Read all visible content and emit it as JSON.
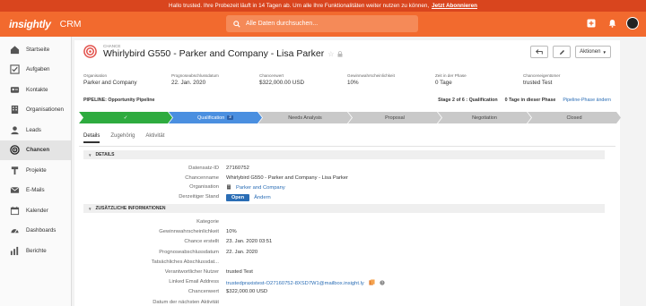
{
  "banner": {
    "message": "Hallo trusted. Ihre Probezeit läuft in 14 Tagen ab. Um alle Ihre Funktionalitäten weiter nutzen zu können,",
    "cta": "Jetzt Abonnieren"
  },
  "topbar": {
    "logo": "insightly",
    "app": "CRM",
    "search_placeholder": "Alle Daten durchsuchen..."
  },
  "sidebar": {
    "items": [
      {
        "label": "Startseite",
        "icon": "home-icon"
      },
      {
        "label": "Aufgaben",
        "icon": "checkbox-icon"
      },
      {
        "label": "Kontakte",
        "icon": "contact-card-icon"
      },
      {
        "label": "Organisationen",
        "icon": "building-icon"
      },
      {
        "label": "Leads",
        "icon": "leads-icon"
      },
      {
        "label": "Chancen",
        "icon": "target-icon"
      },
      {
        "label": "Projekte",
        "icon": "hammer-icon"
      },
      {
        "label": "E-Mails",
        "icon": "envelope-icon"
      },
      {
        "label": "Kalender",
        "icon": "calendar-icon"
      },
      {
        "label": "Dashboards",
        "icon": "dashboard-icon"
      },
      {
        "label": "Berichte",
        "icon": "report-icon"
      }
    ],
    "active_index": 5
  },
  "record": {
    "kicker": "CHANCE",
    "title": "Whirlybird G550 - Parker and Company - Lisa Parker",
    "actions_label": "Aktionen"
  },
  "fields": [
    {
      "label": "Organisation",
      "value": "Parker and Company",
      "link": true
    },
    {
      "label": "Prognoseabschlussdatum",
      "value": "22. Jan. 2020",
      "link": false
    },
    {
      "label": "Chancenwert",
      "value": "$322,000.00 USD",
      "link": false
    },
    {
      "label": "Gewinnwahrscheinlichkeit",
      "value": "10%",
      "link": false
    },
    {
      "label": "Zeit in der Phase",
      "value": "0 Tage",
      "link": false
    },
    {
      "label": "Chanceneigentümer",
      "value": "trusted Test",
      "link": true
    }
  ],
  "pipeline": {
    "label": "PIPELINE: Opportunity Pipeline",
    "stage_info": "Stage 2 of 6 : Qualification",
    "days_in_phase": "0 Tage in dieser Phase",
    "change_link": "Pipeline-Phase ändern",
    "stages": [
      {
        "label": "✓",
        "state": "done"
      },
      {
        "label": "Qualification",
        "state": "current",
        "badge": "2"
      },
      {
        "label": "Needs Analysis",
        "state": "todo"
      },
      {
        "label": "Proposal",
        "state": "todo"
      },
      {
        "label": "Negotiation",
        "state": "todo"
      },
      {
        "label": "Closed",
        "state": "todo"
      }
    ]
  },
  "tabs": [
    "Details",
    "Zugehörig",
    "Aktivität"
  ],
  "details": {
    "title": "DETAILS",
    "rows": [
      {
        "k": "Datensatz-ID",
        "v": "27160752"
      },
      {
        "k": "Chancenname",
        "v": "Whirlybird G550 - Parker and Company - Lisa Parker"
      },
      {
        "k": "Organisation",
        "v": "Parker and Company"
      },
      {
        "k": "Derzeitiger Stand",
        "v": "Open",
        "extra": "Ändern"
      }
    ]
  },
  "extra": {
    "title": "ZUSÄTZLICHE INFORMATIONEN",
    "rows": [
      {
        "k": "Kategorie",
        "v": ""
      },
      {
        "k": "Gewinnwahrscheinlichkeit",
        "v": "10%"
      },
      {
        "k": "Chance erstellt",
        "v": "23. Jan. 2020 03:51"
      },
      {
        "k": "Prognoseabschlussdatum",
        "v": "22. Jan. 2020"
      },
      {
        "k": "Tatsächliches Abschlussdat...",
        "v": ""
      },
      {
        "k": "Verantwortlicher Nutzer",
        "v": "trusted Test"
      },
      {
        "k": "Linked Email Address",
        "v": "trustedpraxistest-O27160752-8XSD7W1@mailbox.insight.ly"
      },
      {
        "k": "Chancenwert",
        "v": "$322,000.00 USD"
      },
      {
        "k": "Datum der nächsten Aktivität",
        "v": ""
      }
    ]
  },
  "colors": {
    "accent": "#f26a2e",
    "done": "#2eab3f",
    "current": "#4a8fe0",
    "todo": "#c9c9c9"
  }
}
